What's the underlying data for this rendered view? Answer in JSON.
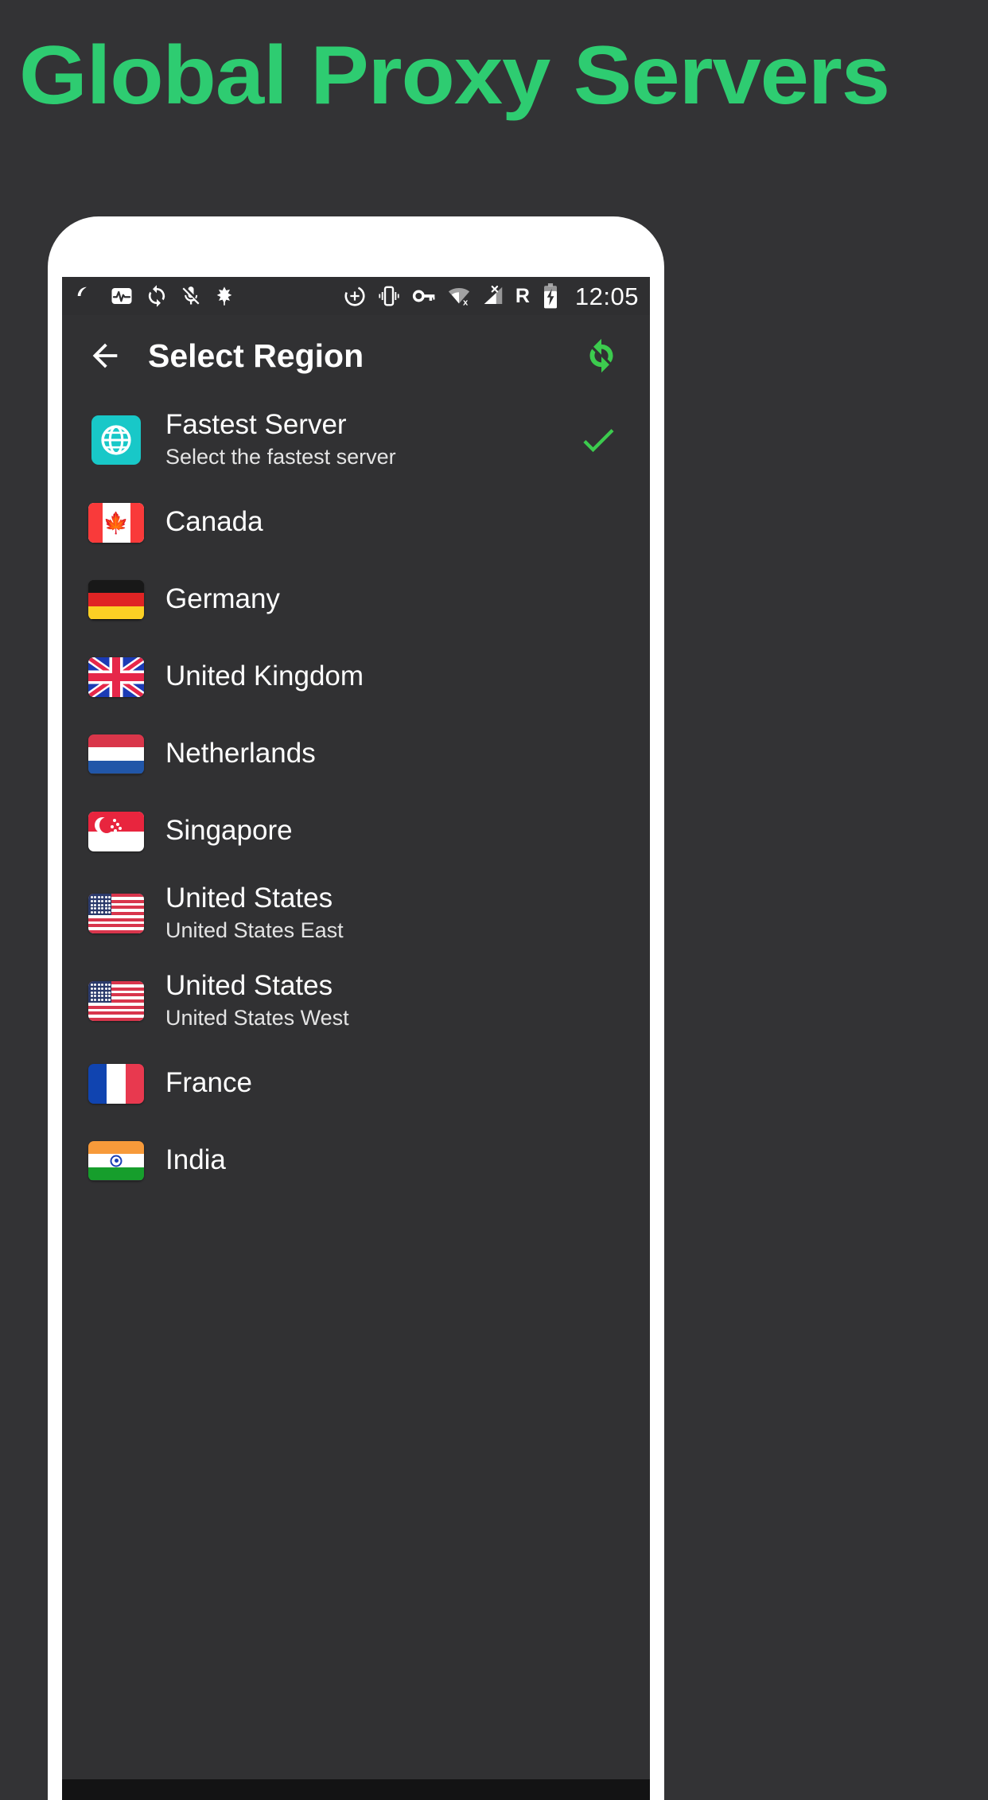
{
  "banner": {
    "headline": "Global Proxy Servers",
    "accent_color": "#2ecc71",
    "background_color": "#333335"
  },
  "status_bar": {
    "left_icons": [
      {
        "name": "moon-sleep-icon",
        "label": "Do not disturb"
      },
      {
        "name": "pulse-monitor-icon",
        "label": "Heart rate monitor"
      },
      {
        "name": "sync-icon",
        "label": "Syncing"
      },
      {
        "name": "mic-muted-icon",
        "label": "Microphone muted"
      },
      {
        "name": "leaf-icon",
        "label": "Power saving"
      }
    ],
    "right_icons": [
      {
        "name": "zoom-in-circle-icon",
        "label": "Magnification"
      },
      {
        "name": "vibrate-icon",
        "label": "Vibrate mode"
      },
      {
        "name": "vpn-key-icon",
        "label": "VPN key"
      },
      {
        "name": "wifi-off-icon",
        "label": "Wi-Fi disconnected"
      },
      {
        "name": "cell-signal-off-icon",
        "label": "No mobile signal"
      }
    ],
    "roaming_label": "R",
    "battery": {
      "name": "battery-charging-icon",
      "label": "Charging"
    },
    "time": "12:05"
  },
  "app_bar": {
    "back_icon": "arrow-back-icon",
    "title": "Select Region",
    "refresh_icon": "refresh-sync-icon",
    "refresh_color": "#3ccb4e"
  },
  "regions": [
    {
      "icon_type": "globe",
      "icon_name": "globe-icon",
      "icon_color": "#18c8c8",
      "title": "Fastest Server",
      "subtitle": "Select the fastest server",
      "selected": true
    },
    {
      "icon_type": "flag",
      "icon_name": "flag-canada-icon",
      "flag_code": "ca",
      "title": "Canada",
      "subtitle": "",
      "selected": false
    },
    {
      "icon_type": "flag",
      "icon_name": "flag-germany-icon",
      "flag_code": "de",
      "title": "Germany",
      "subtitle": "",
      "selected": false
    },
    {
      "icon_type": "flag",
      "icon_name": "flag-united-kingdom-icon",
      "flag_code": "gb",
      "title": "United Kingdom",
      "subtitle": "",
      "selected": false
    },
    {
      "icon_type": "flag",
      "icon_name": "flag-netherlands-icon",
      "flag_code": "nl",
      "title": "Netherlands",
      "subtitle": "",
      "selected": false
    },
    {
      "icon_type": "flag",
      "icon_name": "flag-singapore-icon",
      "flag_code": "sg",
      "title": "Singapore",
      "subtitle": "",
      "selected": false
    },
    {
      "icon_type": "flag",
      "icon_name": "flag-united-states-icon",
      "flag_code": "us",
      "title": "United States",
      "subtitle": "United States East",
      "selected": false
    },
    {
      "icon_type": "flag",
      "icon_name": "flag-united-states-icon",
      "flag_code": "us",
      "title": "United States",
      "subtitle": "United States West",
      "selected": false
    },
    {
      "icon_type": "flag",
      "icon_name": "flag-france-icon",
      "flag_code": "fr",
      "title": "France",
      "subtitle": "",
      "selected": false
    },
    {
      "icon_type": "flag",
      "icon_name": "flag-india-icon",
      "flag_code": "in",
      "title": "India",
      "subtitle": "",
      "selected": false
    }
  ],
  "check_color": "#3ccb4e"
}
